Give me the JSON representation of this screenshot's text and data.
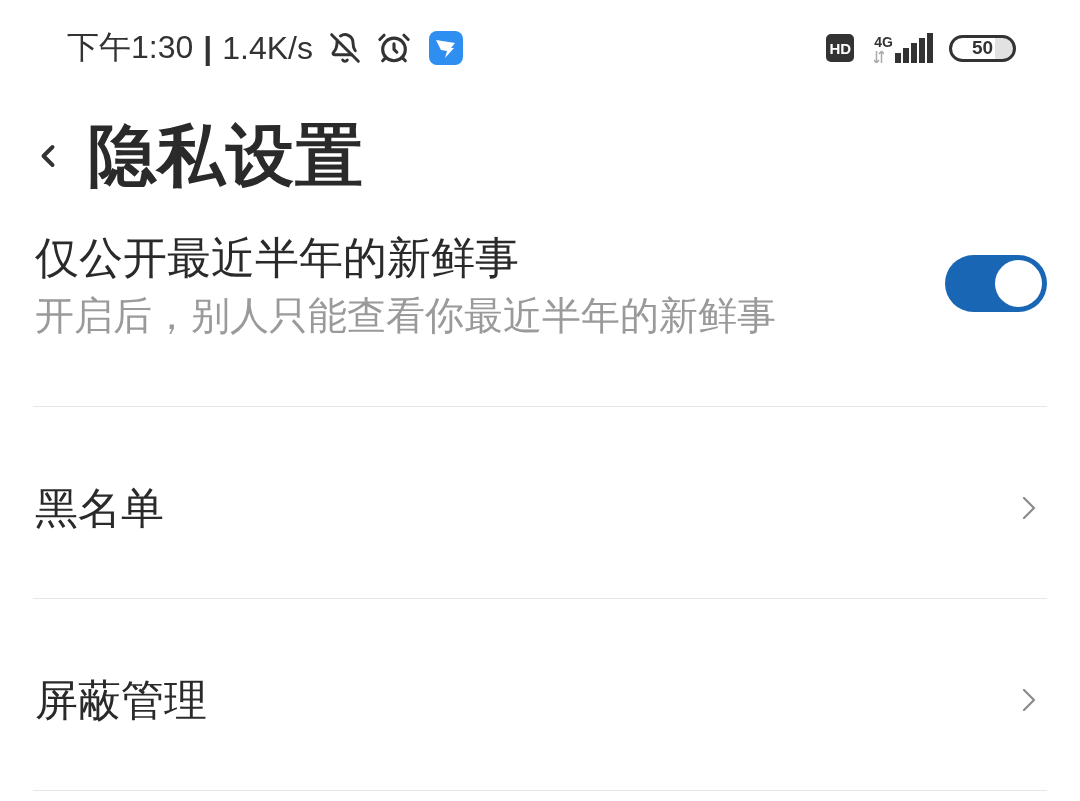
{
  "status_bar": {
    "time": "下午1:30",
    "separator": "|",
    "speed": "1.4K/s",
    "hd_badge": "HD",
    "network": "4G",
    "battery": "50"
  },
  "header": {
    "title": "隐私设置"
  },
  "settings": [
    {
      "kind": "toggle",
      "title": "仅公开最近半年的新鲜事",
      "subtitle": "开启后，别人只能查看你最近半年的新鲜事",
      "on": true
    },
    {
      "kind": "link",
      "title": "黑名单"
    },
    {
      "kind": "link",
      "title": "屏蔽管理"
    }
  ]
}
